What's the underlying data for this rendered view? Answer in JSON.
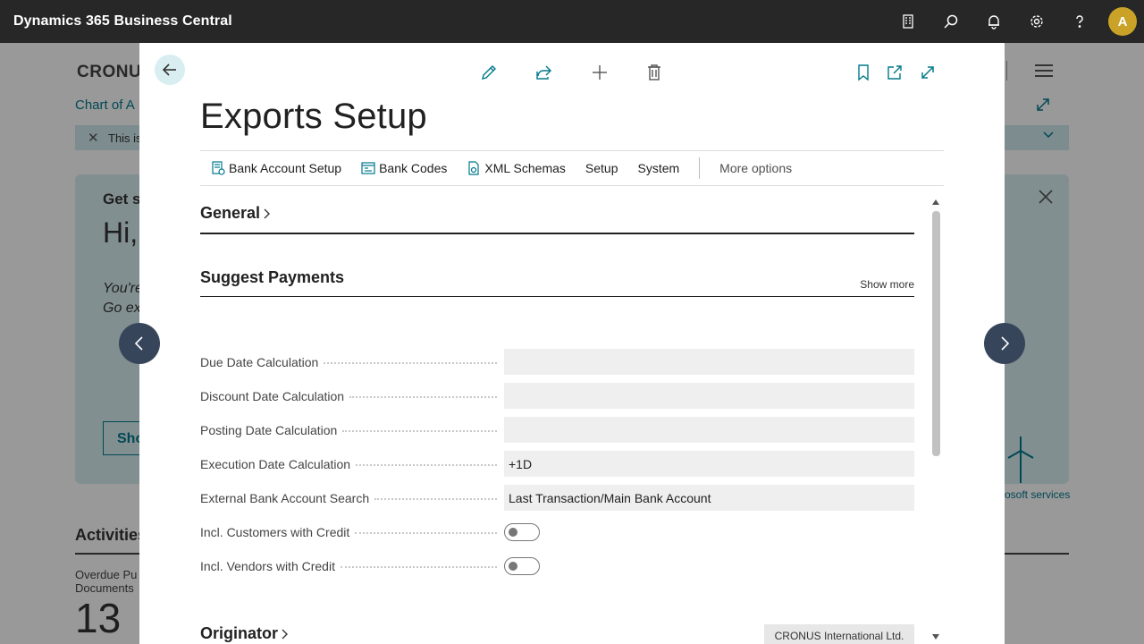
{
  "app": {
    "title": "Dynamics 365 Business Central",
    "avatar_initial": "A"
  },
  "topbar_icons": [
    "document-icon",
    "search-icon",
    "bell-icon",
    "gear-icon",
    "help-icon"
  ],
  "background": {
    "company": "CRONU",
    "breadcrumb": "Chart of A",
    "banner_text": "This is",
    "card_title": "Get s",
    "card_greeting": "Hi,",
    "card_italic_1": "You're",
    "card_italic_2": "Go ex",
    "card_button": "Sho",
    "services_text": "osoft services",
    "activities_title": "Activities",
    "overdue_line1": "Overdue Pu",
    "overdue_line2": "Documents",
    "overdue_count": "13"
  },
  "modal": {
    "title": "Exports Setup",
    "actions": [
      {
        "label": "Bank Account Setup",
        "icon": "bank-setup-icon"
      },
      {
        "label": "Bank Codes",
        "icon": "bank-codes-icon"
      },
      {
        "label": "XML Schemas",
        "icon": "xml-schema-icon"
      },
      {
        "label": "Setup"
      },
      {
        "label": "System"
      }
    ],
    "more_options": "More options",
    "sections": {
      "general": {
        "title": "General"
      },
      "suggest": {
        "title": "Suggest Payments",
        "show_more": "Show more",
        "fields": [
          {
            "label": "Due Date Calculation",
            "value": ""
          },
          {
            "label": "Discount Date Calculation",
            "value": ""
          },
          {
            "label": "Posting Date Calculation",
            "value": ""
          },
          {
            "label": "Execution Date Calculation",
            "value": "+1D"
          },
          {
            "label": "External Bank Account Search",
            "value": "Last Transaction/Main Bank Account"
          }
        ],
        "toggles": [
          {
            "label": "Incl. Customers with Credit",
            "on": false
          },
          {
            "label": "Incl. Vendors with Credit",
            "on": false
          }
        ]
      },
      "originator": {
        "title": "Originator",
        "company": "CRONUS International Ltd."
      }
    }
  },
  "colors": {
    "accent": "#00788c",
    "topbar": "#272727",
    "nav_button": "#37455b"
  }
}
